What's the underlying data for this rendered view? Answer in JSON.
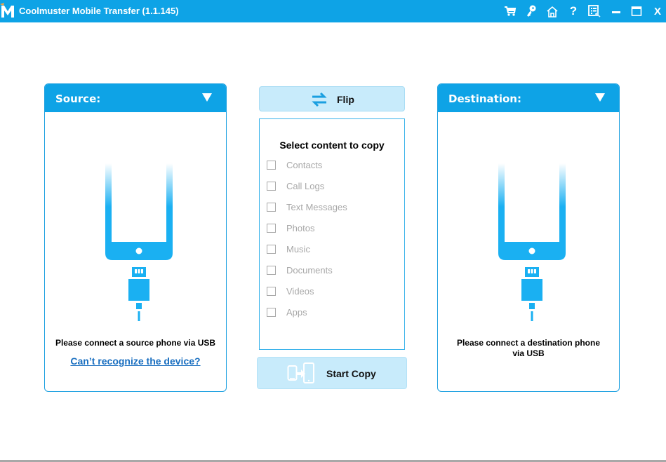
{
  "window": {
    "title": "Coolmuster Mobile Transfer  (1.1.145)",
    "toolbar_icons": [
      "cart-icon",
      "key-icon",
      "home-icon",
      "help-icon",
      "feedback-icon",
      "minimize-icon",
      "maximize-icon",
      "close-icon"
    ],
    "close_label": "X",
    "help_label": "?"
  },
  "source": {
    "header": "Source:",
    "message": "Please connect a source phone via USB",
    "link": "Can’t recognize the device?"
  },
  "destination": {
    "header": "Destination:",
    "message": "Please connect a destination phone via USB"
  },
  "center": {
    "flip_label": "Flip",
    "select_title": "Select content to copy",
    "options": [
      {
        "label": "Contacts",
        "checked": false
      },
      {
        "label": "Call Logs",
        "checked": false
      },
      {
        "label": "Text Messages",
        "checked": false
      },
      {
        "label": "Photos",
        "checked": false
      },
      {
        "label": "Music",
        "checked": false
      },
      {
        "label": "Documents",
        "checked": false
      },
      {
        "label": "Videos",
        "checked": false
      },
      {
        "label": "Apps",
        "checked": false
      }
    ],
    "start_copy_label": "Start Copy"
  },
  "colors": {
    "accent": "#0ea3e6",
    "button_bg": "#c8ebfb",
    "link": "#1a6fc0",
    "disabled_text": "#a8a8a8"
  }
}
